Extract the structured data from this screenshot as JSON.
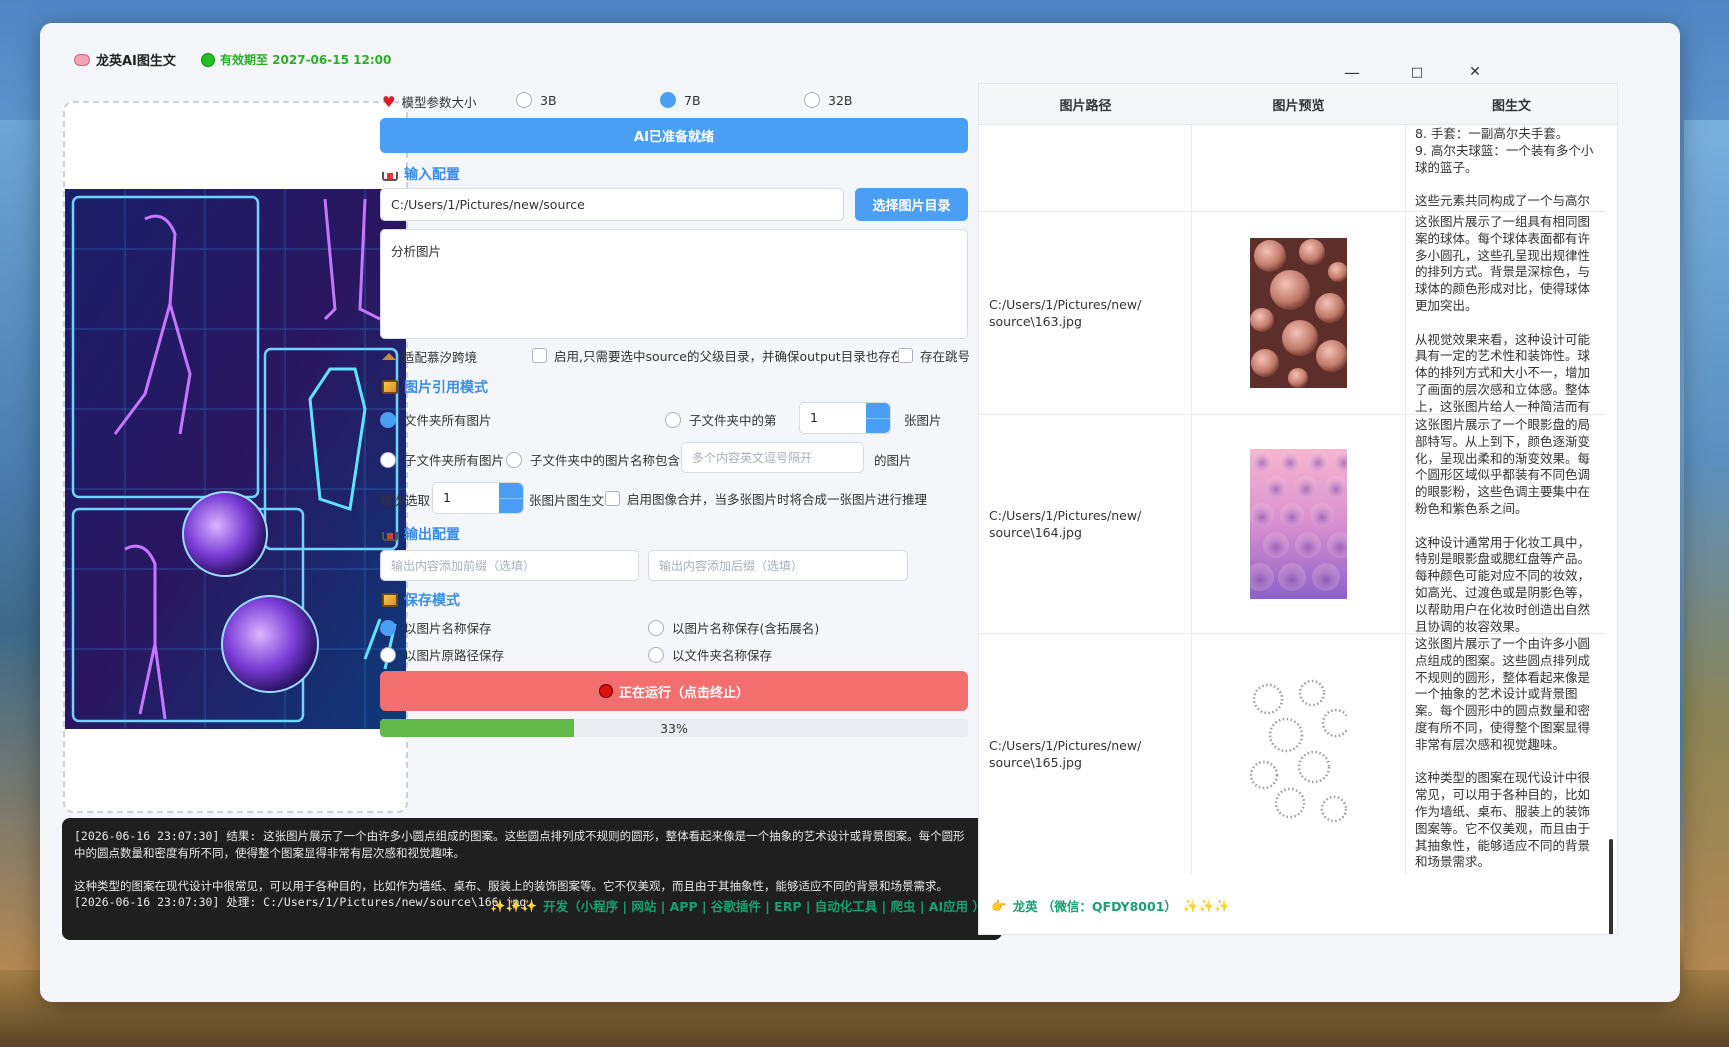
{
  "app": {
    "title": "龙英AI图生文",
    "expiry": "有效期至 2027-06-15 12:00",
    "window_controls": {
      "minimize": "—",
      "maximize": "□",
      "close": "✕"
    }
  },
  "model": {
    "label": "模型参数大小",
    "options": [
      "3B",
      "7B",
      "32B"
    ],
    "selected": "7B",
    "status_button": "AI已准备就绪"
  },
  "input_config": {
    "heading": "输入配置",
    "path_value": "C:/Users/1/Pictures/new/source",
    "select_button": "选择图片目录",
    "prompt_value": "分析图片",
    "cross_label": "适配慕汐跨境",
    "enable_label": "启用,只需要选中source的父级目录，并确保output目录也存在",
    "skip_label": "存在跳号"
  },
  "ref_mode": {
    "heading": "图片引用模式",
    "opt_all": "文件夹所有图片",
    "opt_nth_prefix": "子文件夹中的第",
    "nth_value": "1",
    "opt_nth_suffix": "张图片",
    "opt_sub_all": "子文件夹所有图片",
    "opt_name_contains": "子文件夹中的图片名称包含",
    "contains_placeholder": "多个内容英文逗号隔开",
    "contains_suffix": "的图片",
    "batch_prefix": "每次选取",
    "batch_value": "1",
    "batch_suffix": "张图片图生文",
    "merge_label": "启用图像合并，当多张图片时将合成一张图片进行推理"
  },
  "output_config": {
    "heading": "输出配置",
    "prefix_placeholder": "输出内容添加前缀（选填）",
    "suffix_placeholder": "输出内容添加后缀（选填）"
  },
  "save_mode": {
    "heading": "保存模式",
    "opt_name": "以图片名称保存",
    "opt_name_ext": "以图片名称保存(含拓展名)",
    "opt_path": "以图片原路径保存",
    "opt_folder": "以文件夹名称保存"
  },
  "run": {
    "button": "正在运行（点击终止）",
    "progress": 33,
    "progress_text": "33%"
  },
  "log": [
    "[2026-06-16 23:07:30] 结果: 这张图片展示了一个由许多小圆点组成的图案。这些圆点排列成不规则的圆形，整体看起来像是一个抽象的艺术设计或背景图案。每个圆形中的圆点数量和密度有所不同，使得整个图案显得非常有层次感和视觉趣味。",
    "",
    "这种类型的图案在现代设计中很常见，可以用于各种目的，比如作为墙纸、桌布、服装上的装饰图案等。它不仅美观，而且由于其抽象性，能够适应不同的背景和场景需求。",
    "[2026-06-16 23:07:30] 处理: C:/Users/1/Pictures/new/source\\166.jpg"
  ],
  "table": {
    "headers": [
      "图片路径",
      "图片预览",
      "图生文"
    ],
    "rows": [
      {
        "path": "",
        "text": "8. 手套：一副高尔夫手套。\n9. 高尔夫球篮：一个装有多个小球的篮子。\n\n这些元素共同构成了一个与高尔夫运动相关的主题图案"
      },
      {
        "path": "C:/Users/1/Pictures/new/\nsource\\163.jpg",
        "text": "这张图片展示了一组具有相同图案的球体。每个球体表面都有许多小圆孔，这些孔呈现出规律性的排列方式。背景是深棕色，与球体的颜色形成对比，使得球体更加突出。\n\n从视觉效果来看，这种设计可能具有一定的艺术性和装饰性。球体的排列方式和大小不一，增加了画面的层次感和立体感。整体上，这张图片给人一种简洁而有艺术感的感觉"
      },
      {
        "path": "C:/Users/1/Pictures/new/\nsource\\164.jpg",
        "text": "这张图片展示了一个眼影盘的局部特写。从上到下，颜色逐渐变化，呈现出柔和的渐变效果。每个圆形区域似乎都装有不同色调的眼影粉，这些色调主要集中在粉色和紫色系之间。\n\n这种设计通常用于化妆工具中，特别是眼影盘或腮红盘等产品。每种颜色可能对应不同的妆效，如高光、过渡色或是阴影色等，以帮助用户在化妆时创造出自然且协调的妆容效果。"
      },
      {
        "path": "C:/Users/1/Pictures/new/\nsource\\165.jpg",
        "text": "这张图片展示了一个由许多小圆点组成的图案。这些圆点排列成不规则的圆形，整体看起来像是一个抽象的艺术设计或背景图案。每个圆形中的圆点数量和密度有所不同，使得整个图案显得非常有层次感和视觉趣味。\n\n这种类型的图案在现代设计中很常见，可以用于各种目的，比如作为墙纸、桌布、服装上的装饰图案等。它不仅美观，而且由于其抽象性，能够适应不同的背景和场景需求。"
      }
    ]
  },
  "footer": {
    "text": "开发（小程序 | 网站 | APP | 谷歌插件 | ERP | 自动化工具 | 爬虫 | AI应用 ）",
    "author": "龙英 （微信：QFDY8001）"
  },
  "colors": {
    "accent": "#4a9ff5",
    "run_red": "#f36f6f",
    "progress_green": "#62b94a",
    "expiry_green": "#2bae28"
  }
}
